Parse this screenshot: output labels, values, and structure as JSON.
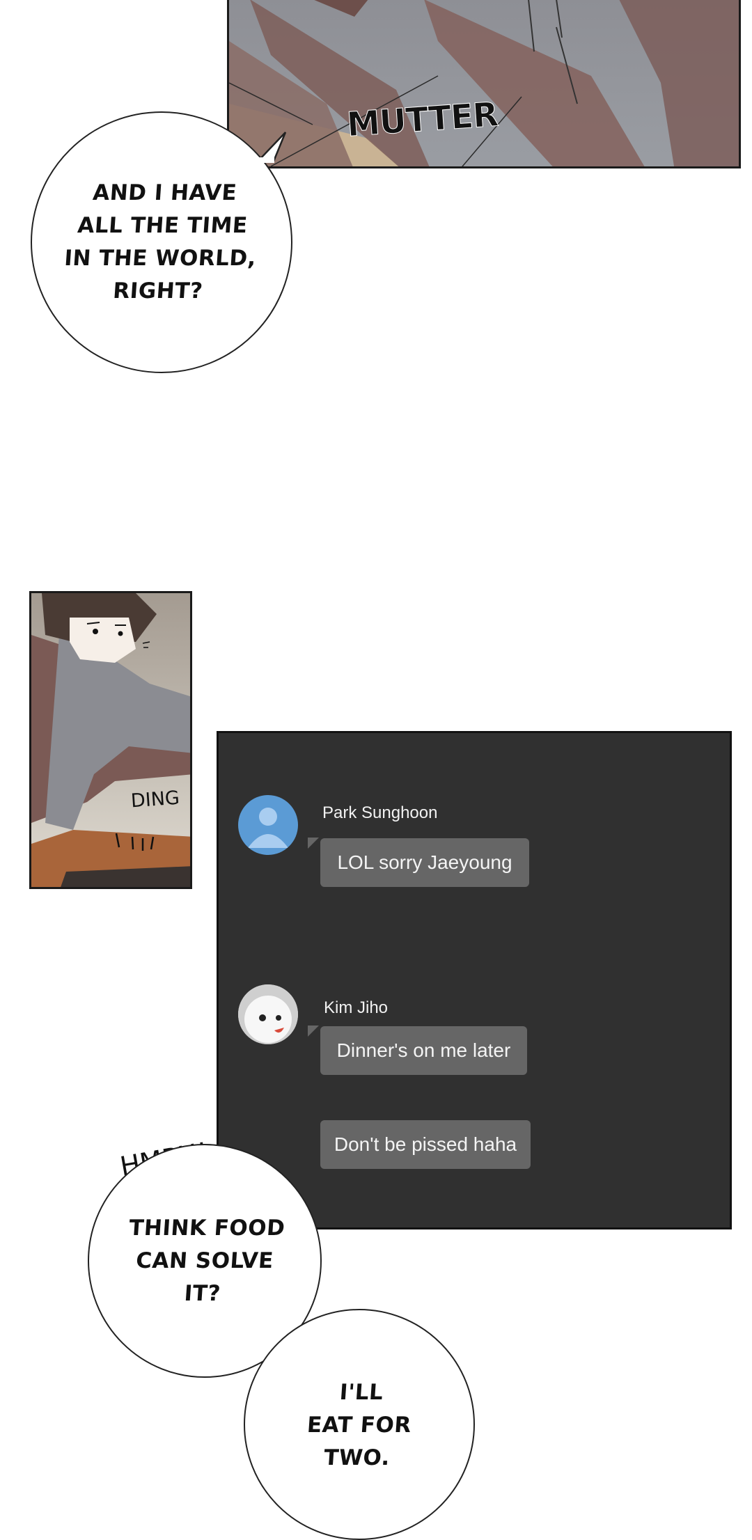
{
  "sfx": {
    "top_panel": "MUTTER",
    "side_panel": "DING",
    "hmph": "HMPH!"
  },
  "bubbles": {
    "time": "AND I HAVE\nALL THE TIME\nIN THE WORLD,\nRIGHT?",
    "food": "THINK FOOD\nCAN SOLVE\nIT?",
    "two": "I'LL\nEAT FOR\nTWO."
  },
  "chat": {
    "messages": [
      {
        "sender": "Park Sunghoon",
        "text": "LOL sorry Jaeyoung"
      },
      {
        "sender": "Kim Jiho",
        "text": "Dinner's on me later"
      },
      {
        "text": "Don't be pissed haha"
      }
    ],
    "colors": {
      "background": "#303030",
      "bubble": "#666666",
      "avatar_blue": "#5b9bd5"
    },
    "avatar_icons": [
      "default-user-icon",
      "cat-avatar-icon"
    ]
  }
}
